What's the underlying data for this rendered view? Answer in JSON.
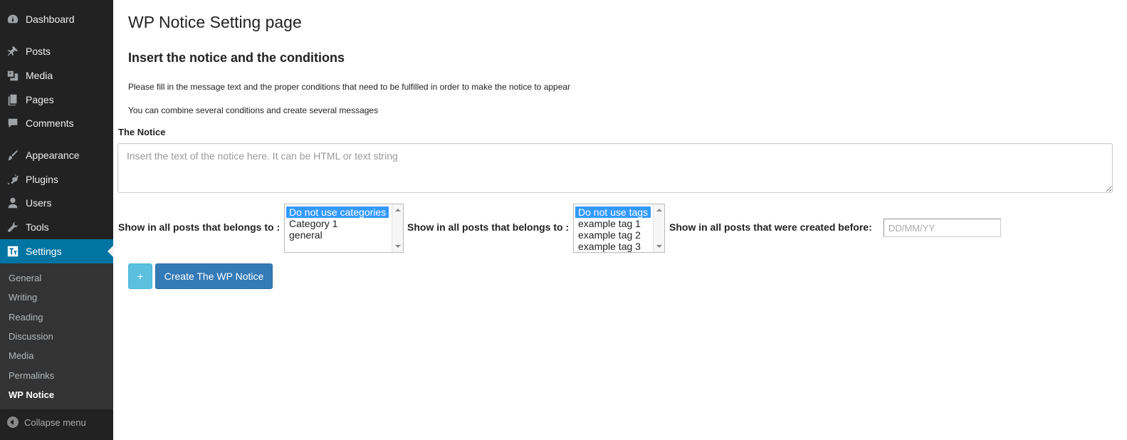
{
  "sidebar": {
    "menu": [
      {
        "label": "Dashboard",
        "icon": "dashboard-icon"
      },
      {
        "label": "Posts",
        "icon": "pin-icon"
      },
      {
        "label": "Media",
        "icon": "media-icon"
      },
      {
        "label": "Pages",
        "icon": "pages-icon"
      },
      {
        "label": "Comments",
        "icon": "comment-icon"
      },
      {
        "label": "Appearance",
        "icon": "brush-icon"
      },
      {
        "label": "Plugins",
        "icon": "plug-icon"
      },
      {
        "label": "Users",
        "icon": "user-icon"
      },
      {
        "label": "Tools",
        "icon": "wrench-icon"
      },
      {
        "label": "Settings",
        "icon": "settings-icon"
      }
    ],
    "submenu": [
      "General",
      "Writing",
      "Reading",
      "Discussion",
      "Media",
      "Permalinks",
      "WP Notice"
    ],
    "collapse_label": "Collapse menu",
    "active_color": "#0074a2"
  },
  "main": {
    "page_title": "WP Notice Setting page",
    "section_title": "Insert the notice and the conditions",
    "paragraph1": "Please fill in the message text and the proper conditions that need to be fulfilled in order to make the notice to appear",
    "paragraph2": "You can combine several conditions and create several messages",
    "notice_label": "The Notice",
    "notice_placeholder": "Insert the text of the notice here. It can be HTML or text string",
    "conditions": {
      "category_label": "Show in all posts that belongs to :",
      "categories": [
        "Do not use categories",
        "Category 1",
        "general"
      ],
      "tag_label": "Show in all posts that belongs to :",
      "tags": [
        "Do not use tags",
        "example tag 1",
        "example tag 2",
        "example tag 3"
      ],
      "date_label": "Show in all posts that were created before:",
      "date_placeholder": "DD/MM/YY"
    },
    "add_button": "+",
    "create_button": "Create The WP Notice"
  }
}
